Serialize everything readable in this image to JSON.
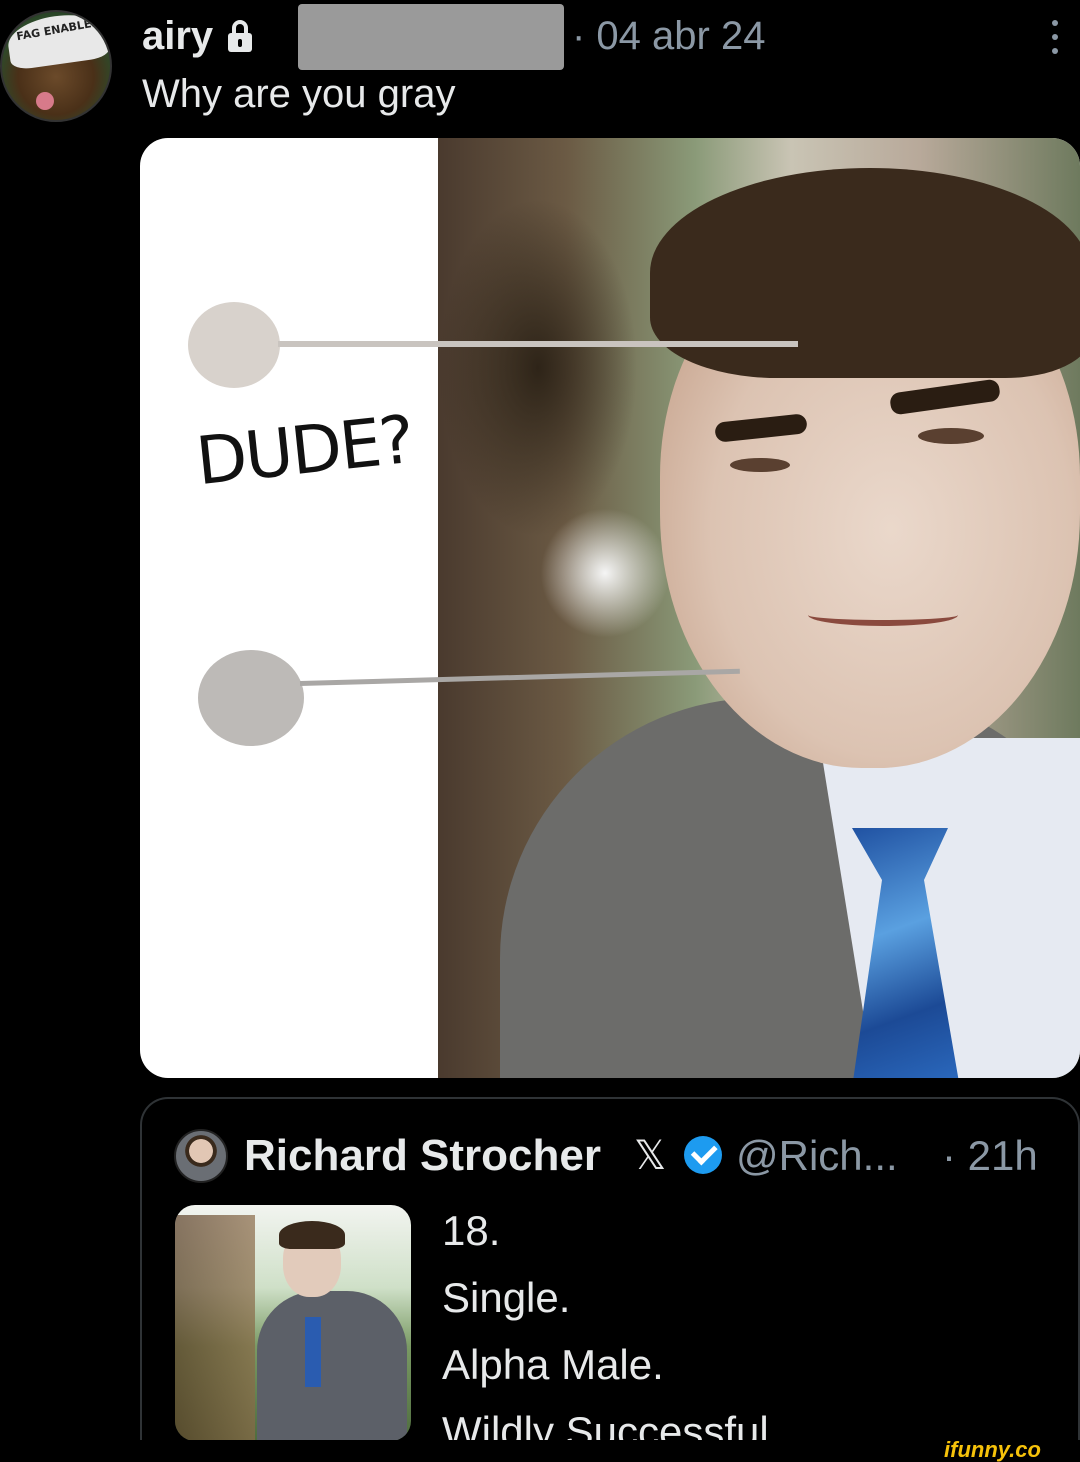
{
  "tweet": {
    "author": "airy",
    "timestamp": "· 04 abr 24",
    "text": "Why are you gray",
    "media": {
      "caption": "DUDE?"
    }
  },
  "avatar": {
    "hat_text": "FAG ENABLER"
  },
  "quote": {
    "name": "Richard Strocher",
    "x_icon": "𝕏",
    "handle": "@Rich...",
    "time": "· 21h",
    "lines": [
      "18.",
      "Single.",
      "Alpha Male.",
      "Wildly Successful...."
    ]
  },
  "watermark": "ifunny.co",
  "colors": {
    "background": "#000000",
    "text": "#e7e9ea",
    "muted": "#8b98a5",
    "verified": "#1d9bf0",
    "watermark": "#f6c20a"
  },
  "icons": [
    "lock-icon",
    "more-icon",
    "x-logo-icon",
    "verified-badge-icon"
  ]
}
